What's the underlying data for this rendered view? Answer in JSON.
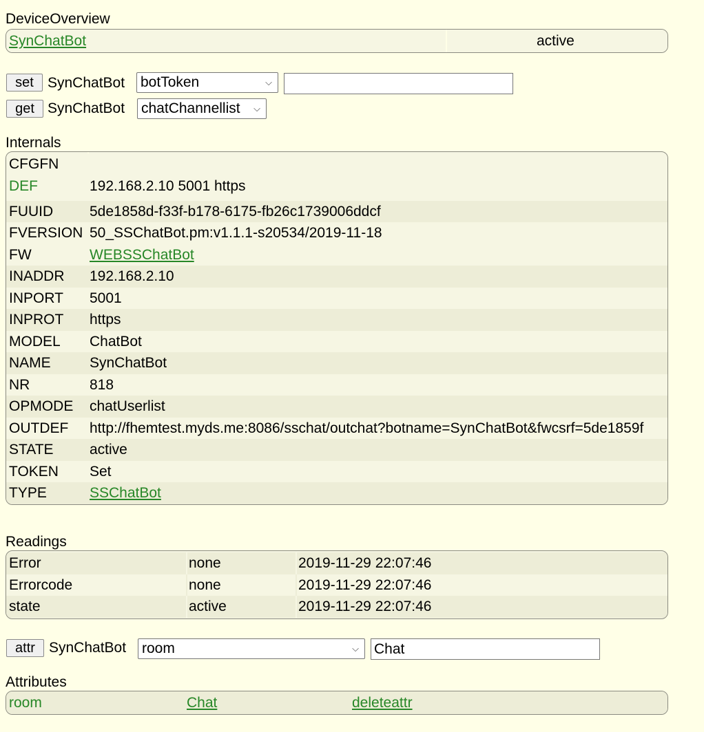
{
  "overview": {
    "title": "DeviceOverview",
    "device_name": "SynChatBot",
    "state": "active"
  },
  "set_row": {
    "button": "set",
    "device": "SynChatBot",
    "selected": "botToken",
    "value": ""
  },
  "get_row": {
    "button": "get",
    "device": "SynChatBot",
    "selected": "chatChannellist"
  },
  "internals": {
    "title": "Internals",
    "rows": [
      {
        "key": "CFGFN",
        "value": ""
      },
      {
        "key": "DEF",
        "value": "192.168.2.10 5001 https"
      },
      {
        "key": "FUUID",
        "value": "5de1858d-f33f-b178-6175-fb26c1739006ddcf"
      },
      {
        "key": "FVERSION",
        "value": "50_SSChatBot.pm:v1.1.1-s20534/2019-11-18"
      },
      {
        "key": "FW",
        "value": "WEBSSChatBot"
      },
      {
        "key": "INADDR",
        "value": "192.168.2.10"
      },
      {
        "key": "INPORT",
        "value": "5001"
      },
      {
        "key": "INPROT",
        "value": "https"
      },
      {
        "key": "MODEL",
        "value": "ChatBot"
      },
      {
        "key": "NAME",
        "value": "SynChatBot"
      },
      {
        "key": "NR",
        "value": "818"
      },
      {
        "key": "OPMODE",
        "value": "chatUserlist"
      },
      {
        "key": "OUTDEF",
        "value": "http://fhemtest.myds.me:8086/sschat/outchat?botname=SynChatBot&fwcsrf=5de1859f"
      },
      {
        "key": "STATE",
        "value": "active"
      },
      {
        "key": "TOKEN",
        "value": "Set"
      },
      {
        "key": "TYPE",
        "value": "SSChatBot"
      }
    ]
  },
  "readings": {
    "title": "Readings",
    "rows": [
      {
        "name": "Error",
        "value": "none",
        "time": "2019-11-29 22:07:46"
      },
      {
        "name": "Errorcode",
        "value": "none",
        "time": "2019-11-29 22:07:46"
      },
      {
        "name": "state",
        "value": "active",
        "time": "2019-11-29 22:07:46"
      }
    ]
  },
  "attr_row": {
    "button": "attr",
    "device": "SynChatBot",
    "selected": "room",
    "value": "Chat"
  },
  "attributes": {
    "title": "Attributes",
    "rows": [
      {
        "name": "room",
        "value": "Chat",
        "action": "deleteattr"
      }
    ]
  },
  "colors": {
    "background": "#ffffe7",
    "link": "#278727",
    "row_odd": "#f6f6e3",
    "row_even": "#ededd7"
  }
}
